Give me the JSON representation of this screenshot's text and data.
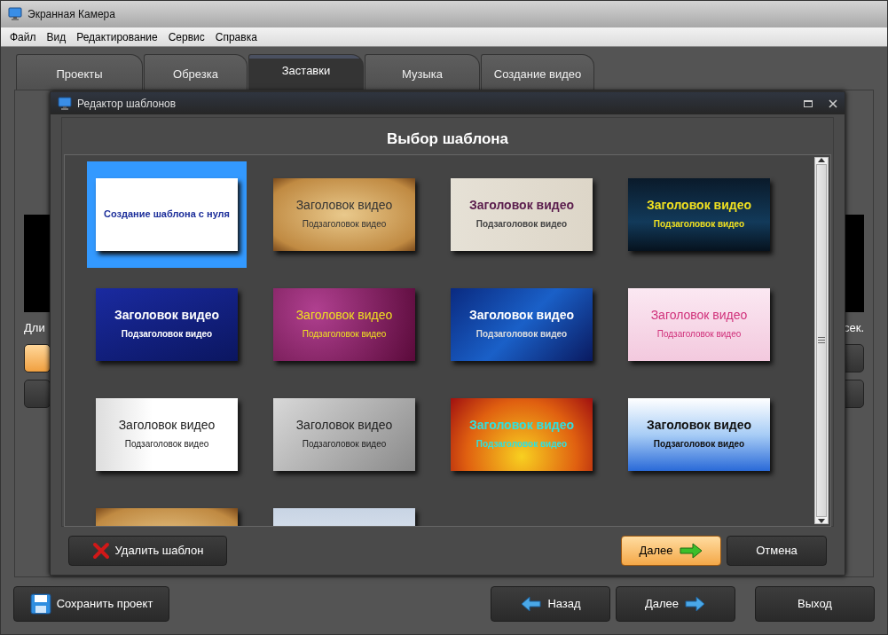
{
  "window": {
    "title": "Экранная Камера"
  },
  "menu": [
    "Файл",
    "Вид",
    "Редактирование",
    "Сервис",
    "Справка"
  ],
  "tabs": [
    {
      "label": "Проекты",
      "selected": false
    },
    {
      "label": "Обрезка",
      "selected": false
    },
    {
      "label": "Заставки",
      "selected": true
    },
    {
      "label": "Музыка",
      "selected": false
    },
    {
      "label": "Создание видео",
      "selected": false
    }
  ],
  "background_panel": {
    "left_text": "Дли",
    "right_text": "сек."
  },
  "dialog": {
    "title": "Редактор шаблонов",
    "heading": "Выбор шаблона",
    "templates": [
      {
        "kind": "blank",
        "title": "Создание шаблона с нуля",
        "selected": true
      },
      {
        "kind": "parchment",
        "title": "Заголовок видео",
        "subtitle": "Подзаголовок видео",
        "selected": false
      },
      {
        "kind": "ink",
        "title": "Заголовок видео",
        "subtitle": "Подзаголовок видео",
        "selected": false
      },
      {
        "kind": "night",
        "title": "Заголовок видео",
        "subtitle": "Подзаголовок видео",
        "selected": false
      },
      {
        "kind": "rainbow",
        "title": "Заголовок видео",
        "subtitle": "Подзаголовок видео",
        "selected": false
      },
      {
        "kind": "floral",
        "title": "Заголовок видео",
        "subtitle": "Подзаголовок видео",
        "selected": false
      },
      {
        "kind": "rays",
        "title": "Заголовок видео",
        "subtitle": "Подзаголовок видео",
        "selected": false
      },
      {
        "kind": "pink",
        "title": "Заголовок видео",
        "subtitle": "Подзаголовок видео",
        "selected": false
      },
      {
        "kind": "speakers",
        "title": "Заголовок видео",
        "subtitle": "Подзаголовок видео",
        "selected": false
      },
      {
        "kind": "gray",
        "title": "Заголовок видео",
        "subtitle": "Подзаголовок видео",
        "selected": false
      },
      {
        "kind": "sparkle",
        "title": "Заголовок видео",
        "subtitle": "Подзаголовок видео",
        "selected": false
      },
      {
        "kind": "film",
        "title": "Заголовок видео",
        "subtitle": "Подзаголовок видео",
        "selected": false
      },
      {
        "kind": "parchment",
        "selected": false
      },
      {
        "kind": "frost",
        "selected": false
      }
    ],
    "buttons": [
      {
        "label": "Удалить шаблон",
        "kind": "delete"
      },
      {
        "label": "Далее",
        "kind": "next-default"
      },
      {
        "label": "Отмена",
        "kind": "cancel"
      }
    ]
  },
  "footer_buttons": [
    {
      "label": "Сохранить проект",
      "kind": "save"
    },
    {
      "label": "Назад",
      "kind": "back"
    },
    {
      "label": "Далее",
      "kind": "next"
    },
    {
      "label": "Выход",
      "kind": "exit"
    }
  ]
}
